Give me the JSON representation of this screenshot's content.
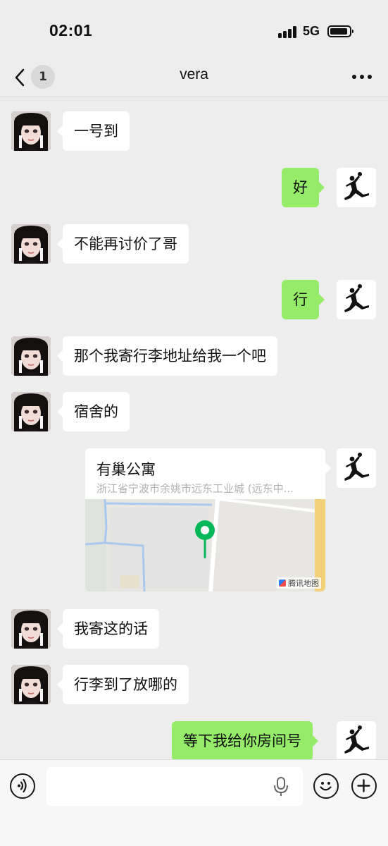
{
  "status_bar": {
    "time": "02:01",
    "network": "5G",
    "icons": [
      "signal-icon",
      "battery-icon"
    ]
  },
  "nav": {
    "back_icon": "chevron-left-icon",
    "unread_count": "1",
    "title": "vera",
    "more_icon": "more-icon"
  },
  "contact_avatar": "girl-avatar",
  "self_avatar": "jumpman-logo-avatar",
  "messages": [
    {
      "side": "in",
      "type": "text",
      "text": "一号到"
    },
    {
      "side": "out",
      "type": "text",
      "text": "好"
    },
    {
      "side": "in",
      "type": "text",
      "text": "不能再讨价了哥"
    },
    {
      "side": "out",
      "type": "text",
      "text": "行"
    },
    {
      "side": "in",
      "type": "text",
      "text": "那个我寄行李地址给我一个吧"
    },
    {
      "side": "in",
      "type": "text",
      "text": "宿舍的"
    },
    {
      "side": "out",
      "type": "location",
      "name": "有巢公寓",
      "address": "浙江省宁波市余姚市远东工业城 (远东中...",
      "map_credit": "腾讯地图"
    },
    {
      "side": "in",
      "type": "text",
      "text": "我寄这的话"
    },
    {
      "side": "in",
      "type": "text",
      "text": "行李到了放哪的"
    },
    {
      "side": "out",
      "type": "text",
      "text": "等下我给你房间号"
    }
  ],
  "input_bar": {
    "voice_icon": "voice-icon",
    "mic_icon": "mic-icon",
    "emoji_icon": "emoji-icon",
    "plus_icon": "plus-icon",
    "placeholder": ""
  },
  "colors": {
    "background": "#ededed",
    "outgoing_bubble": "#95ec69",
    "incoming_bubble": "#ffffff",
    "map_pin": "#07b85b"
  }
}
